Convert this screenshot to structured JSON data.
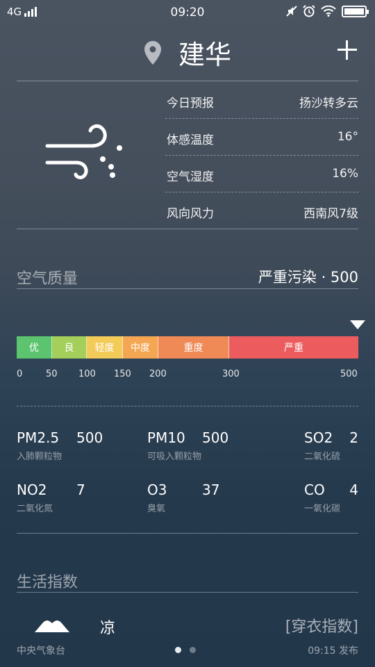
{
  "status_bar": {
    "network": "4G",
    "time": "09:20"
  },
  "header": {
    "city": "建华"
  },
  "forecast": [
    {
      "label": "今日预报",
      "value": "扬沙转多云"
    },
    {
      "label": "体感温度",
      "value": "16°"
    },
    {
      "label": "空气湿度",
      "value": "16%"
    },
    {
      "label": "风向风力",
      "value": "西南风7级"
    }
  ],
  "air_quality": {
    "title": "空气质量",
    "summary": "严重污染 · 500",
    "level_fraction": 1.0,
    "segments": [
      {
        "label": "优",
        "color": "#5cc46e"
      },
      {
        "label": "良",
        "color": "#a3cf5a"
      },
      {
        "label": "轻度",
        "color": "#f3cb59"
      },
      {
        "label": "中度",
        "color": "#f4a653"
      },
      {
        "label": "重度",
        "color": "#ef8a57"
      },
      {
        "label": "严重",
        "color": "#ec5b5e"
      }
    ],
    "ticks": [
      "0",
      "50",
      "100",
      "150",
      "200",
      "300",
      "500"
    ]
  },
  "pollutants": [
    {
      "name": "PM2.5",
      "value": "500",
      "desc": "入肺颗粒物"
    },
    {
      "name": "PM10",
      "value": "500",
      "desc": "可吸入颗粒物"
    },
    {
      "name": "SO2",
      "value": "2",
      "desc": "二氧化硫"
    },
    {
      "name": "NO2",
      "value": "7",
      "desc": "二氧化氮"
    },
    {
      "name": "O3",
      "value": "37",
      "desc": "臭氧"
    },
    {
      "name": "CO",
      "value": "4",
      "desc": "一氧化碳"
    }
  ],
  "life_index": {
    "title": "生活指数",
    "wear_value": "凉",
    "wear_label": "[穿衣指数]"
  },
  "footer": {
    "source": "中央气象台",
    "publish_time": "09:15 发布",
    "page_count": 2,
    "active_page": 1
  },
  "icons": {
    "location": "location-pin-icon",
    "add": "plus-icon",
    "weather": "wind-icon",
    "clothing": "clothing-icon"
  }
}
